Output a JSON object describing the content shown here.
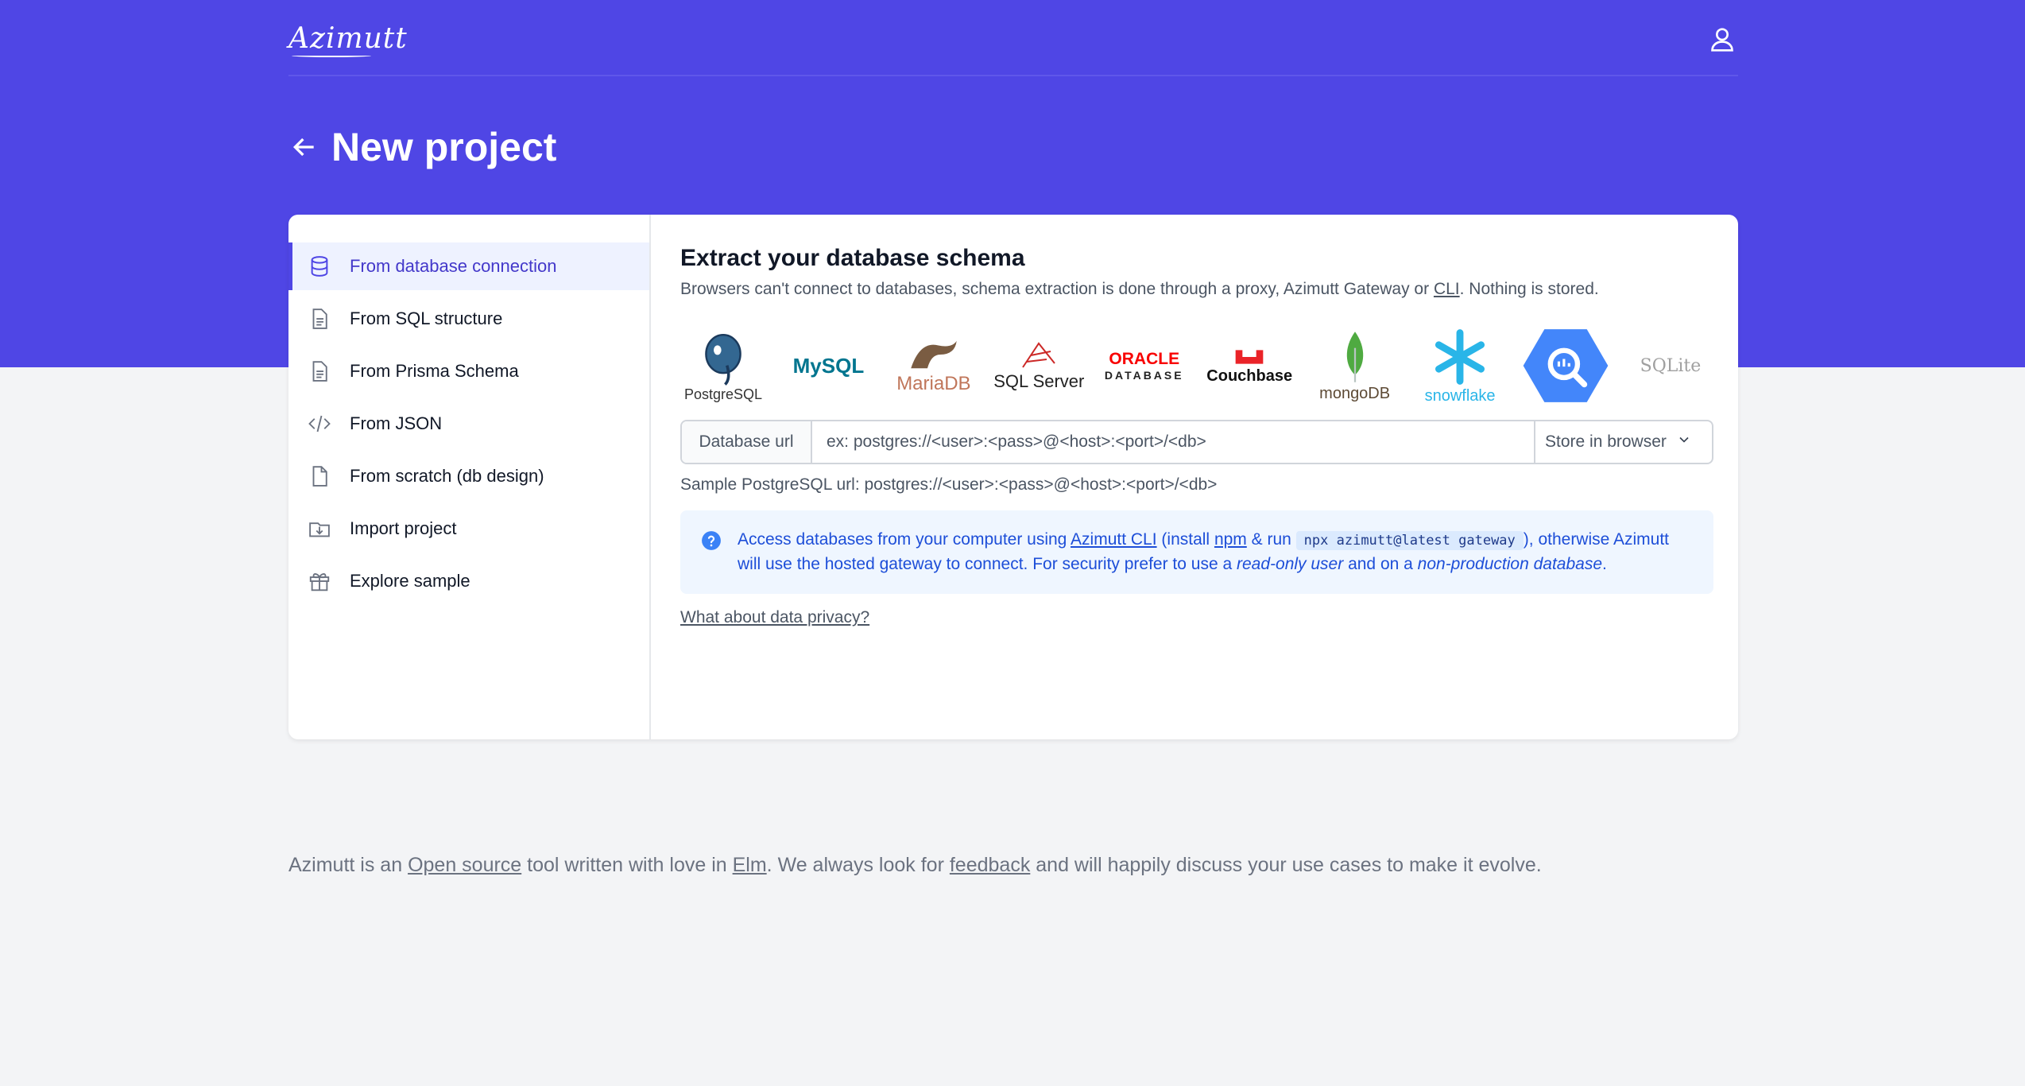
{
  "header": {
    "logo": "Azimutt",
    "user_icon": "user-icon",
    "title": "New project",
    "back_icon": "arrow-left-icon"
  },
  "sidebar": {
    "items": [
      {
        "label": "From database connection",
        "icon": "database-icon",
        "active": true
      },
      {
        "label": "From SQL structure",
        "icon": "document-icon",
        "active": false
      },
      {
        "label": "From Prisma Schema",
        "icon": "document-icon",
        "active": false
      },
      {
        "label": "From JSON",
        "icon": "code-icon",
        "active": false
      },
      {
        "label": "From scratch (db design)",
        "icon": "blank-document-icon",
        "active": false
      },
      {
        "label": "Import project",
        "icon": "folder-download-icon",
        "active": false
      },
      {
        "label": "Explore sample",
        "icon": "gift-icon",
        "active": false
      }
    ]
  },
  "main": {
    "title": "Extract your database schema",
    "desc_before_cli": "Browsers can't connect to databases, schema extraction is done through a proxy, Azimutt Gateway or ",
    "desc_cli_link": "CLI",
    "desc_after_cli": ". Nothing is stored.",
    "databases": [
      {
        "name": "PostgreSQL",
        "color": "#336791"
      },
      {
        "name": "MySQL",
        "color": "#00758f"
      },
      {
        "name": "MariaDB",
        "color": "#c0765a"
      },
      {
        "name": "SQL Server",
        "color": "#cc2927"
      },
      {
        "name": "ORACLE",
        "sub": "DATABASE",
        "color": "#f80000"
      },
      {
        "name": "Couchbase",
        "color": "#ea2328"
      },
      {
        "name": "mongoDB",
        "color": "#4faa41"
      },
      {
        "name": "snowflake",
        "color": "#29b5e8"
      },
      {
        "name": "BigQuery",
        "color": "#4386fa"
      },
      {
        "name": "SQLite",
        "color": "#a0a0a0"
      }
    ],
    "url_addon": "Database url",
    "url_placeholder": "ex: postgres://<user>:<pass>@<host>:<port>/<db>",
    "store_label": "Store in browser",
    "sample": "Sample PostgreSQL url: postgres://<user>:<pass>@<host>:<port>/<db>",
    "info": {
      "t1": "Access databases from your computer using ",
      "cli_link": "Azimutt CLI",
      "t2": " (install ",
      "npm_link": "npm",
      "t3": " & run ",
      "code": "npx azimutt@latest gateway",
      "t4": "), otherwise Azimutt will use the hosted gateway to connect. For security prefer to use a ",
      "em1": "read-only user",
      "t5": " and on a ",
      "em2": "non-production database",
      "t6": "."
    },
    "privacy_link": "What about data privacy?"
  },
  "footer": {
    "t1": "Azimutt is an ",
    "open_source": "Open source",
    "t2": " tool written with love in ",
    "elm": "Elm",
    "t3": ". We always look for ",
    "feedback": "feedback",
    "t4": " and will happily discuss your use cases to make it evolve."
  },
  "colors": {
    "brand": "#4f46e5",
    "active_bg": "#eef2ff",
    "info_bg": "#eff6ff"
  }
}
